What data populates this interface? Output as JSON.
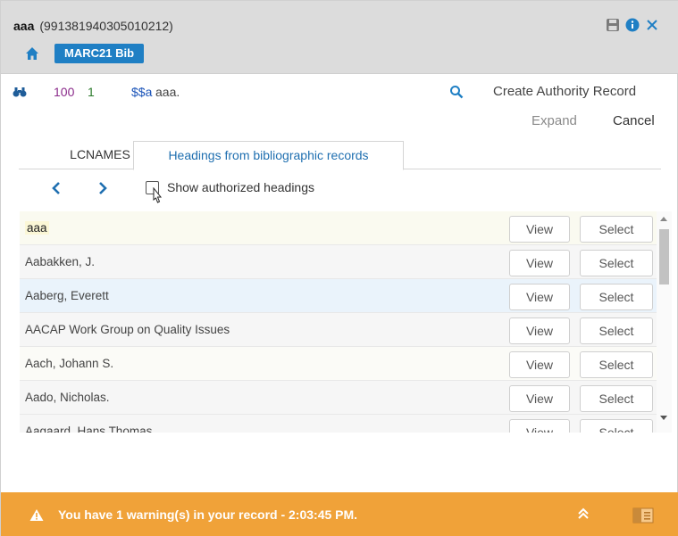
{
  "header": {
    "record_name": "aaa",
    "record_id": "(991381940305010212)",
    "format_badge": "MARC21 Bib"
  },
  "field": {
    "tag": "100",
    "indicator": "1",
    "subfield_code": "$$a",
    "subfield_value": "aaa.",
    "create_authority_label": "Create Authority Record",
    "expand_label": "Expand",
    "cancel_label": "Cancel"
  },
  "tabs": [
    {
      "label": "LCNAMES",
      "active": false
    },
    {
      "label": "Headings from bibliographic records",
      "active": true
    }
  ],
  "nav": {
    "show_authorized_label": "Show authorized headings",
    "show_authorized_checked": false
  },
  "list": {
    "view_label": "View",
    "select_label": "Select",
    "rows": [
      {
        "name": "aaa"
      },
      {
        "name": "Aabakken, J."
      },
      {
        "name": "Aaberg, Everett"
      },
      {
        "name": "AACAP Work Group on Quality Issues"
      },
      {
        "name": "Aach, Johann S."
      },
      {
        "name": "Aado, Nicholas."
      },
      {
        "name": "Aagaard, Hans Thomas"
      }
    ]
  },
  "warning": {
    "text": "You have 1 warning(s) in your record - 2:03:45 PM."
  },
  "colors": {
    "badge": "#1f7fc4",
    "warning_bar": "#f0a239",
    "tab_link": "#1f6fb0",
    "tag": "#8a2a8a",
    "indicator": "#2a7a2a",
    "subfield_code": "#1a53b8"
  },
  "icons": {
    "home": "home-icon",
    "save": "save-icon",
    "info": "info-icon",
    "close": "close-icon",
    "binoculars": "binoculars-icon",
    "search": "search-icon",
    "prev": "chevron-left-icon",
    "next": "chevron-right-icon",
    "warning": "warning-icon",
    "collapse": "chevron-double-up-icon",
    "panel": "panel-toggle-icon"
  }
}
